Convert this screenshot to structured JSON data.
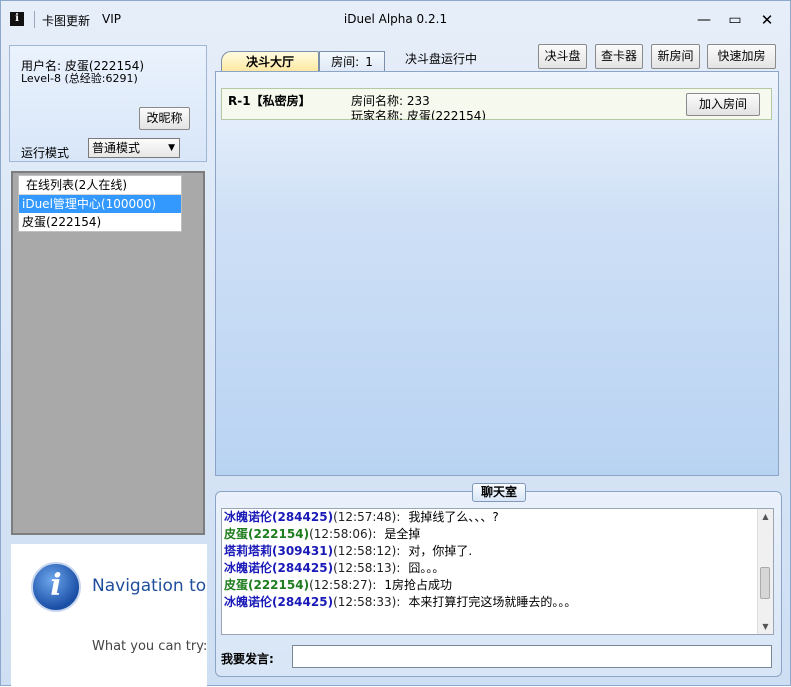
{
  "titlebar": {
    "app_icon": "i",
    "update_label": "卡图更新",
    "vip_label": "VIP",
    "title": "iDuel Alpha 0.2.1",
    "min_icon": "—",
    "max_icon": "▭",
    "close_icon": "✕"
  },
  "user": {
    "name_line": "用户名: 皮蛋(222154)",
    "level_line": "Level-8 (总经验:6291)",
    "rename_label": "改昵称",
    "mode_label": "运行模式",
    "mode_value": "普通模式",
    "mode_arrow": "▼"
  },
  "online": {
    "header": "在线列表(2人在线)",
    "items": [
      {
        "label": "iDuel管理中心(100000)",
        "selected": true
      },
      {
        "label": "皮蛋(222154)",
        "selected": false
      }
    ]
  },
  "nav": {
    "icon": "i",
    "title": "Navigation to the webpage was canceled",
    "try_text": "What you can try:"
  },
  "tabs": {
    "hall": "决斗大厅",
    "room": "房间:",
    "room_count": "1",
    "status": "决斗盘运行中"
  },
  "toolbar": {
    "duel_disk": "决斗盘",
    "card_checker": "查卡器",
    "new_room": "新房间",
    "quick_join": "快速加房"
  },
  "room": {
    "id": "R-1【私密房】",
    "name_line": "房间名称:   233",
    "player_line": "玩家名称:  皮蛋(222154)",
    "join_label": "加入房间"
  },
  "chat": {
    "title": "聊天室",
    "lines": [
      {
        "name": "冰魄诺伦(284425)",
        "time": "(12:57:48):",
        "msg": "我掉线了么、、、?",
        "color": "#1a1ab8"
      },
      {
        "name": "皮蛋(222154)",
        "time": "(12:58:06):",
        "msg": "是全掉",
        "color": "#1e7d1e"
      },
      {
        "name": "塔莉塔莉(309431)",
        "time": "(12:58:12):",
        "msg": "对，你掉了.",
        "color": "#1a1ab8"
      },
      {
        "name": "冰魄诺伦(284425)",
        "time": "(12:58:13):",
        "msg": "囧。。。",
        "color": "#1a1ab8"
      },
      {
        "name": "皮蛋(222154)",
        "time": "(12:58:27):",
        "msg": "1房抢占成功",
        "color": "#1e7d1e"
      },
      {
        "name": "冰魄诺伦(284425)",
        "time": "(12:58:33):",
        "msg": "本来打算打完这场就睡去的。。。",
        "color": "#1a1ab8"
      }
    ],
    "say_label": "我要发言:",
    "say_value": "",
    "scroll_up": "▲",
    "scroll_down": "▼"
  }
}
